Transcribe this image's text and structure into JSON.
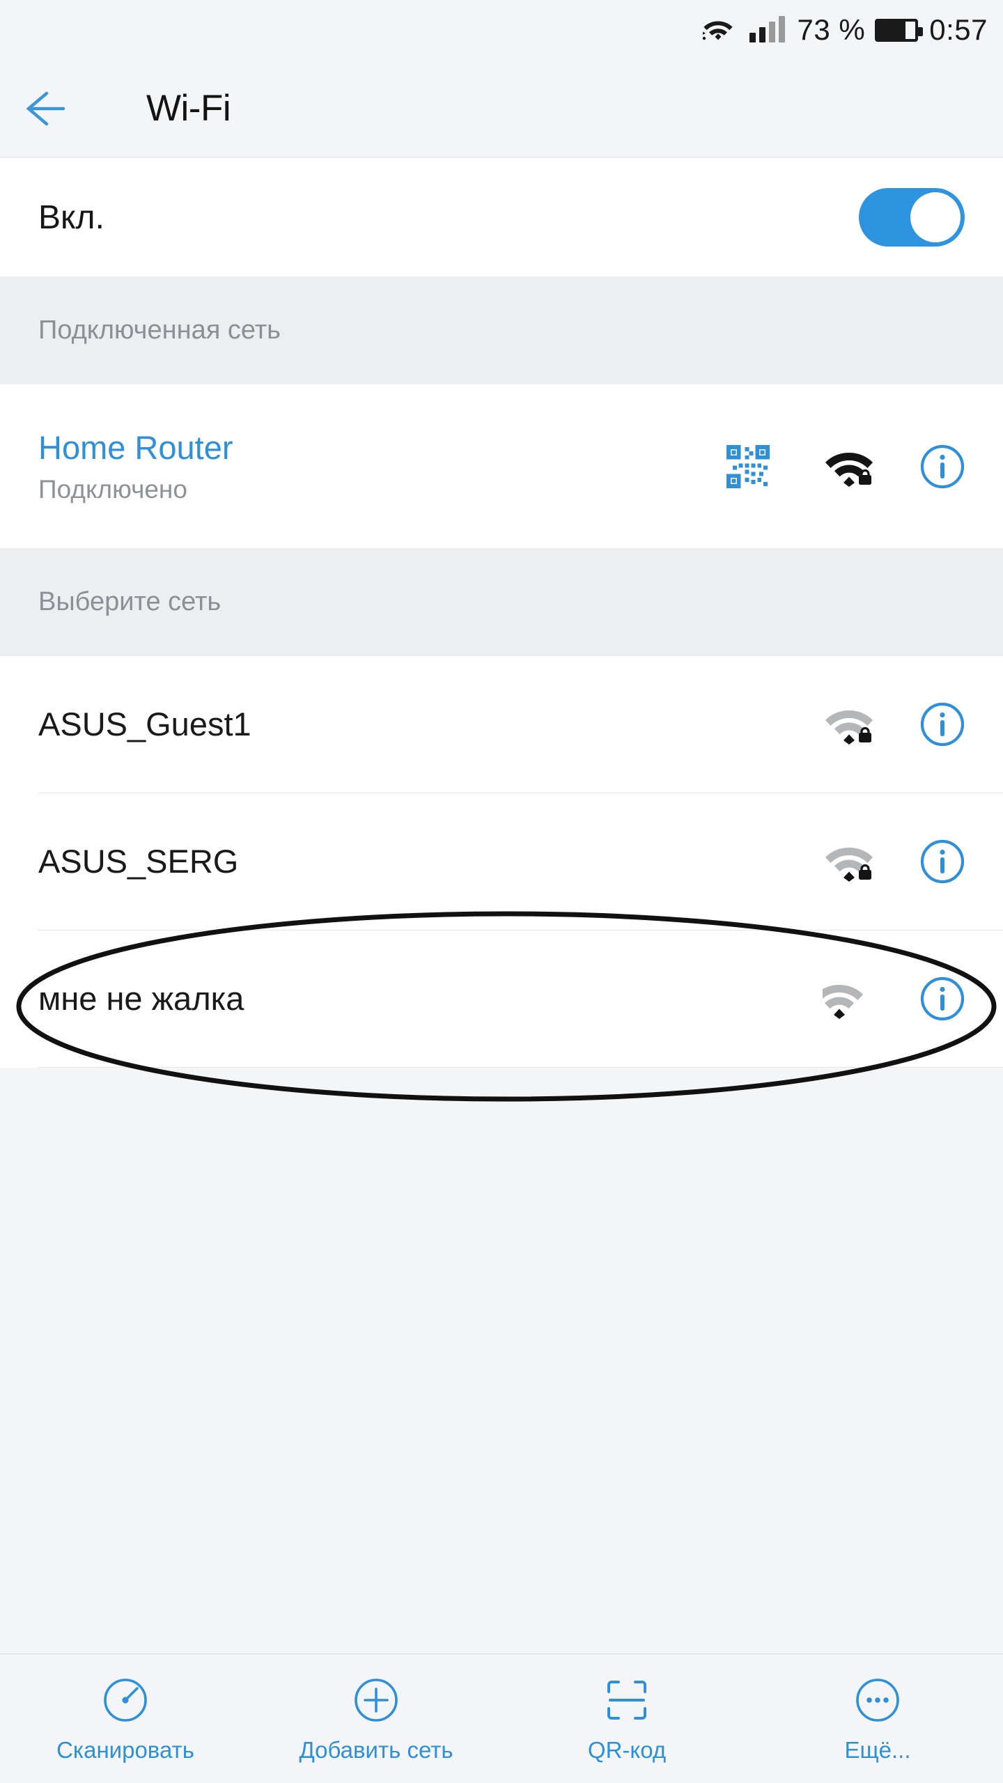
{
  "status_bar": {
    "wifi_icon": "wifi-icon",
    "signal_icon": "signal-bars-icon",
    "battery_percent": "73 %",
    "battery_level": 73,
    "battery_icon": "battery-icon",
    "time": "0:57"
  },
  "header": {
    "back_icon": "back-arrow-icon",
    "title": "Wi-Fi"
  },
  "wifi_toggle": {
    "label": "Вкл.",
    "state": "on"
  },
  "sections": [
    {
      "heading": "Подключенная сеть",
      "networks": [
        {
          "ssid": "Home Router",
          "status": "Подключено",
          "connected": true,
          "secured": true,
          "signal": "strong",
          "has_qr": true,
          "qr_icon": "qr-code-icon",
          "wifi_icon": "wifi-signal-icon",
          "info_icon": "info-icon"
        }
      ]
    },
    {
      "heading": "Выберите сеть",
      "networks": [
        {
          "ssid": "ASUS_Guest1",
          "status": "",
          "connected": false,
          "secured": true,
          "signal": "weak",
          "has_qr": false,
          "wifi_icon": "wifi-signal-icon",
          "info_icon": "info-icon"
        },
        {
          "ssid": "ASUS_SERG",
          "status": "",
          "connected": false,
          "secured": true,
          "signal": "weak",
          "has_qr": false,
          "wifi_icon": "wifi-signal-icon",
          "info_icon": "info-icon"
        },
        {
          "ssid": "мне не жалка",
          "status": "",
          "connected": false,
          "secured": false,
          "signal": "weak",
          "has_qr": false,
          "wifi_icon": "wifi-signal-icon",
          "info_icon": "info-icon",
          "annotated": true
        }
      ]
    }
  ],
  "annotation": {
    "shape": "ellipse",
    "color": "#111111",
    "target": "мне не жалка"
  },
  "bottom_bar": [
    {
      "label": "Сканировать",
      "icon": "scan-gauge-icon"
    },
    {
      "label": "Добавить сеть",
      "icon": "plus-circle-icon"
    },
    {
      "label": "QR-код",
      "icon": "qr-scanner-frame-icon"
    },
    {
      "label": "Ещё...",
      "icon": "more-dots-icon"
    }
  ],
  "colors": {
    "accent": "#2f90da",
    "toggle_on": "#2f94e0",
    "page_background": "#f4f5f6",
    "row_background": "#ffffff",
    "section_background": "#eceef0",
    "primary_text": "#1a1a1a",
    "secondary_text": "#8b9097",
    "divider": "#e4e5e7"
  }
}
